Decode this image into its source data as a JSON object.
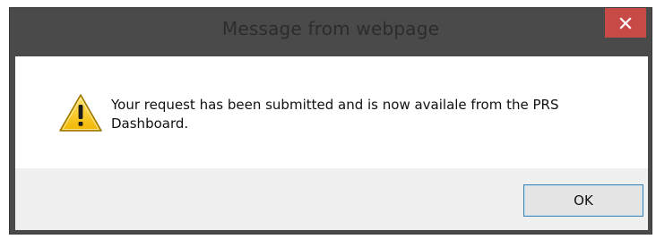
{
  "dialog": {
    "title": "Message from webpage",
    "close_icon": "close-icon",
    "message": "Your request has been submitted and is now availale from the PRS Dashboard.",
    "icon": "warning-icon",
    "ok_label": "OK"
  },
  "colors": {
    "frame": "#4a4a4a",
    "title_text": "#2c2c2c",
    "close_button": "#c74a47",
    "button_bar": "#f0f0f0",
    "ok_border": "#3c7fb1"
  }
}
